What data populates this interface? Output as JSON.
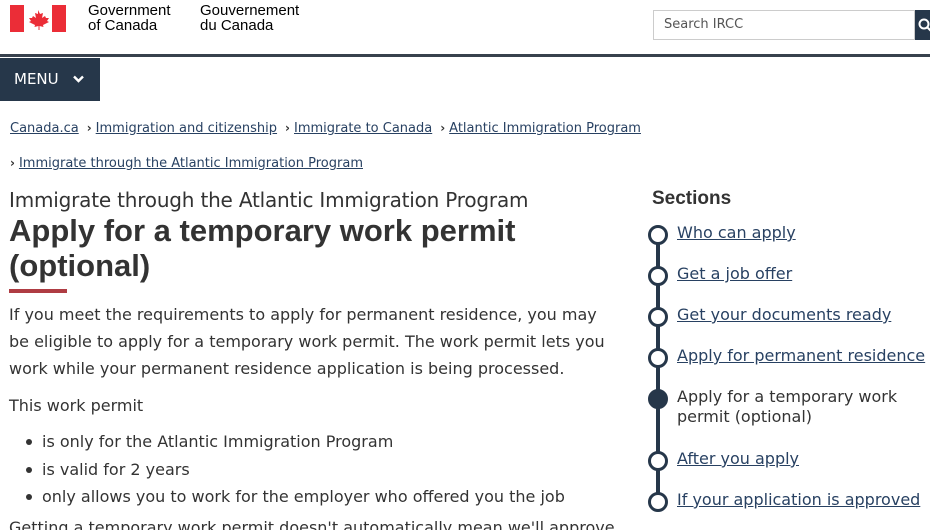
{
  "header": {
    "gov_name_en_line1": "Government",
    "gov_name_en_line2": "of Canada",
    "gov_name_fr_line1": "Gouvernement",
    "gov_name_fr_line2": "du Canada",
    "flag_colors": {
      "red": "#eb2d37",
      "white": "#ffffff"
    },
    "search": {
      "placeholder": "Search IRCC",
      "value": ""
    },
    "menu_label": "MENU"
  },
  "breadcrumb": [
    {
      "label": "Canada.ca"
    },
    {
      "label": "Immigration and citizenship"
    },
    {
      "label": "Immigrate to Canada"
    },
    {
      "label": "Atlantic Immigration Program"
    },
    {
      "label": "Immigrate through the Atlantic Immigration Program"
    }
  ],
  "main": {
    "kicker": "Immigrate through the Atlantic Immigration Program",
    "title": "Apply for a temporary work permit (optional)",
    "intro": "If you meet the requirements to apply for permanent residence, you may be eligible to apply for a temporary work permit. The work permit lets you work while your permanent residence application is being processed.",
    "list_lead": "This work permit",
    "bullets": [
      "is only for the Atlantic Immigration Program",
      "is valid for 2 years",
      "only allows you to work for the employer who offered you the job"
    ],
    "cutoff_text": "Getting a temporary work permit doesn't automatically mean we'll approve"
  },
  "sections": {
    "title": "Sections",
    "items": [
      {
        "label": "Who can apply",
        "current": false
      },
      {
        "label": "Get a job offer",
        "current": false
      },
      {
        "label": "Get your documents ready",
        "current": false
      },
      {
        "label": "Apply for permanent residence",
        "current": false
      },
      {
        "label": "Apply for a temporary work permit (optional)",
        "current": true
      },
      {
        "label": "After you apply",
        "current": false
      },
      {
        "label": "If your application is approved",
        "current": false
      }
    ]
  },
  "colors": {
    "nav_dark": "#26374a",
    "link": "#284162",
    "accent_red": "#af3c43",
    "text": "#333333"
  }
}
